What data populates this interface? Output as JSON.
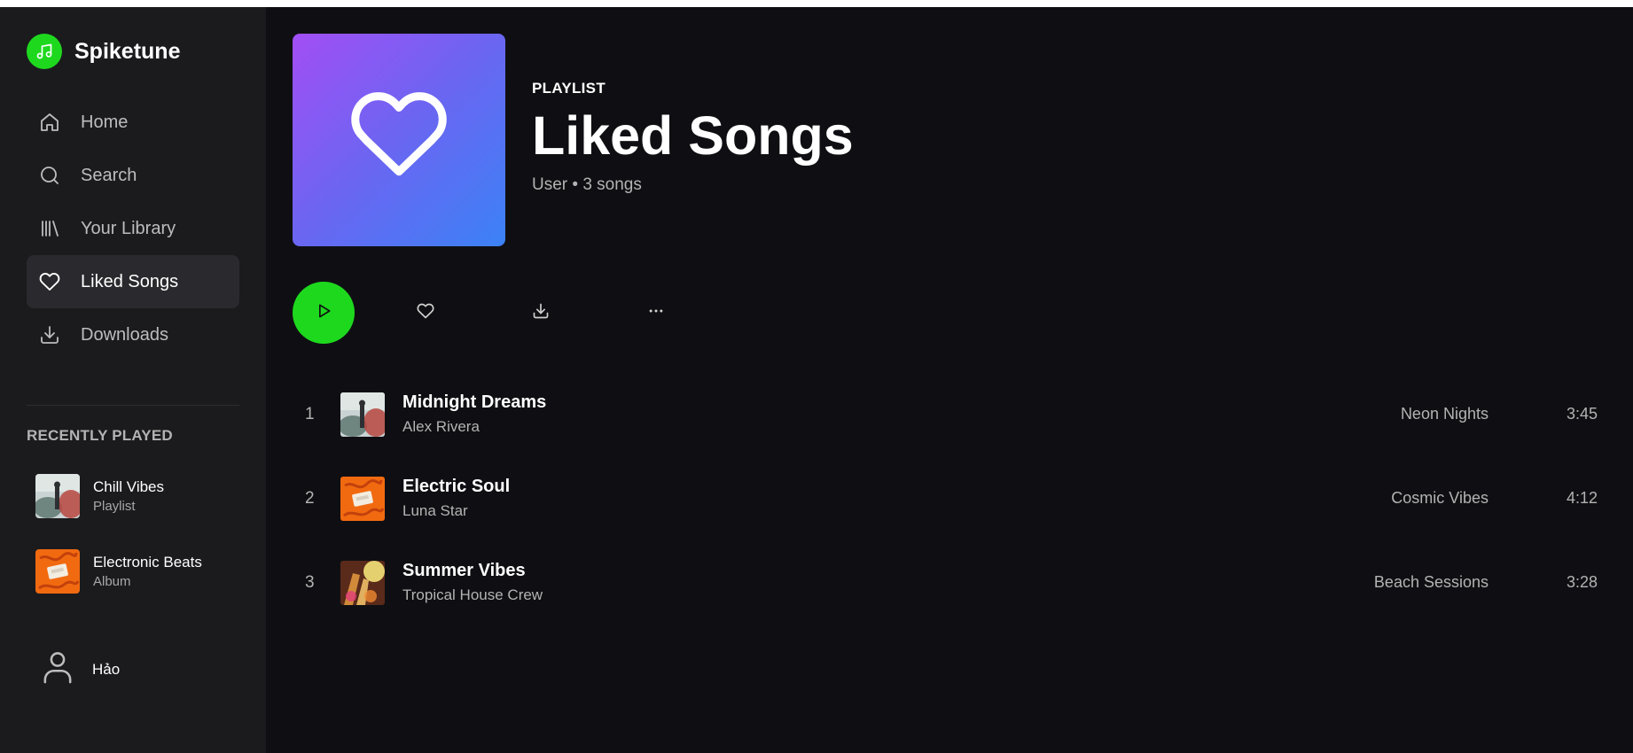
{
  "brand": {
    "name": "Spiketune",
    "icon": "music-note-icon",
    "accent": "#1ed81e"
  },
  "nav": {
    "items": [
      {
        "label": "Home",
        "icon": "home-icon"
      },
      {
        "label": "Search",
        "icon": "search-icon"
      },
      {
        "label": "Your Library",
        "icon": "library-icon"
      },
      {
        "label": "Liked Songs",
        "icon": "heart-icon",
        "active": true
      },
      {
        "label": "Downloads",
        "icon": "download-icon"
      }
    ]
  },
  "recent": {
    "title": "RECENTLY PLAYED",
    "items": [
      {
        "name": "Chill Vibes",
        "type": "Playlist"
      },
      {
        "name": "Electronic Beats",
        "type": "Album"
      }
    ]
  },
  "user": {
    "name": "Hảo",
    "icon": "user-icon"
  },
  "playlist": {
    "type": "PLAYLIST",
    "title": "Liked Songs",
    "meta": "User • 3 songs",
    "cover_icon": "heart-icon"
  },
  "tracks": [
    {
      "num": "1",
      "title": "Midnight Dreams",
      "artist": "Alex Rivera",
      "album": "Neon Nights",
      "duration": "3:45"
    },
    {
      "num": "2",
      "title": "Electric Soul",
      "artist": "Luna Star",
      "album": "Cosmic Vibes",
      "duration": "4:12"
    },
    {
      "num": "3",
      "title": "Summer Vibes",
      "artist": "Tropical House Crew",
      "album": "Beach Sessions",
      "duration": "3:28"
    }
  ]
}
